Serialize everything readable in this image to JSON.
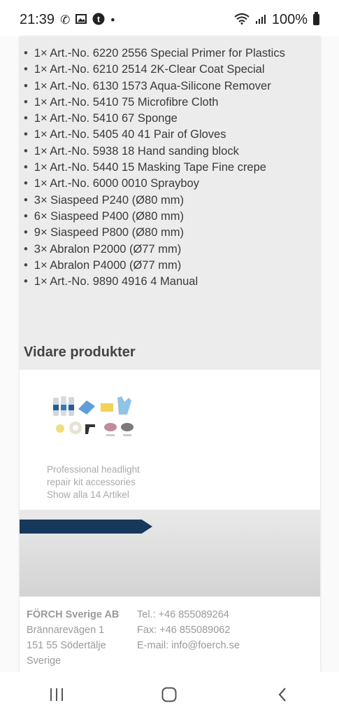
{
  "status_bar": {
    "time": "21:39",
    "battery": "100%",
    "icons": [
      "phone-call-icon",
      "image-icon",
      "t-app-icon",
      "dot-icon",
      "wifi-icon",
      "signal-icon",
      "battery-icon"
    ]
  },
  "items": [
    "1× Art.-No. 6220 2556 Special Primer for Plastics",
    "1× Art.-No. 6210 2514 2K-Clear Coat Special",
    "1× Art.-No. 6130 1573 Aqua-Silicone Remover",
    "1× Art.-No. 5410 75 Microfibre Cloth",
    "1× Art.-No. 5410 67 Sponge",
    "1× Art.-No. 5405 40 41 Pair of Gloves",
    "1× Art.-No. 5938 18 Hand sanding block",
    "1× Art.-No. 5440 15 Masking Tape Fine crepe",
    "1× Art.-No. 6000 0010 Sprayboy",
    "3× Siaspeed P240 (Ø80 mm)",
    "6× Siaspeed P400 (Ø80 mm)",
    "9× Siaspeed P800 (Ø80 mm)",
    "3× Abralon P2000 (Ø77 mm)",
    "1× Abralon P4000 (Ø77 mm)",
    "1× Art.-No. 9890 4916 4 Manual"
  ],
  "more_products": {
    "heading": "Vidare produkter",
    "product_name_line1": "Professional headlight",
    "product_name_line2": "repair kit accessories",
    "show_all": "Show alla 14 Artikel"
  },
  "footer": {
    "company": "FÖRCH Sverige AB",
    "street": "Brännarevägen 1",
    "city": "151 55 Södertälje",
    "country": "Sverige",
    "phone": "Tel.: +46 855089264",
    "fax": "Fax: +46 855089062",
    "email": "E-mail: info@foerch.se"
  },
  "nav_bar": {
    "buttons": [
      "recent-apps-icon",
      "home-icon",
      "back-icon"
    ]
  }
}
